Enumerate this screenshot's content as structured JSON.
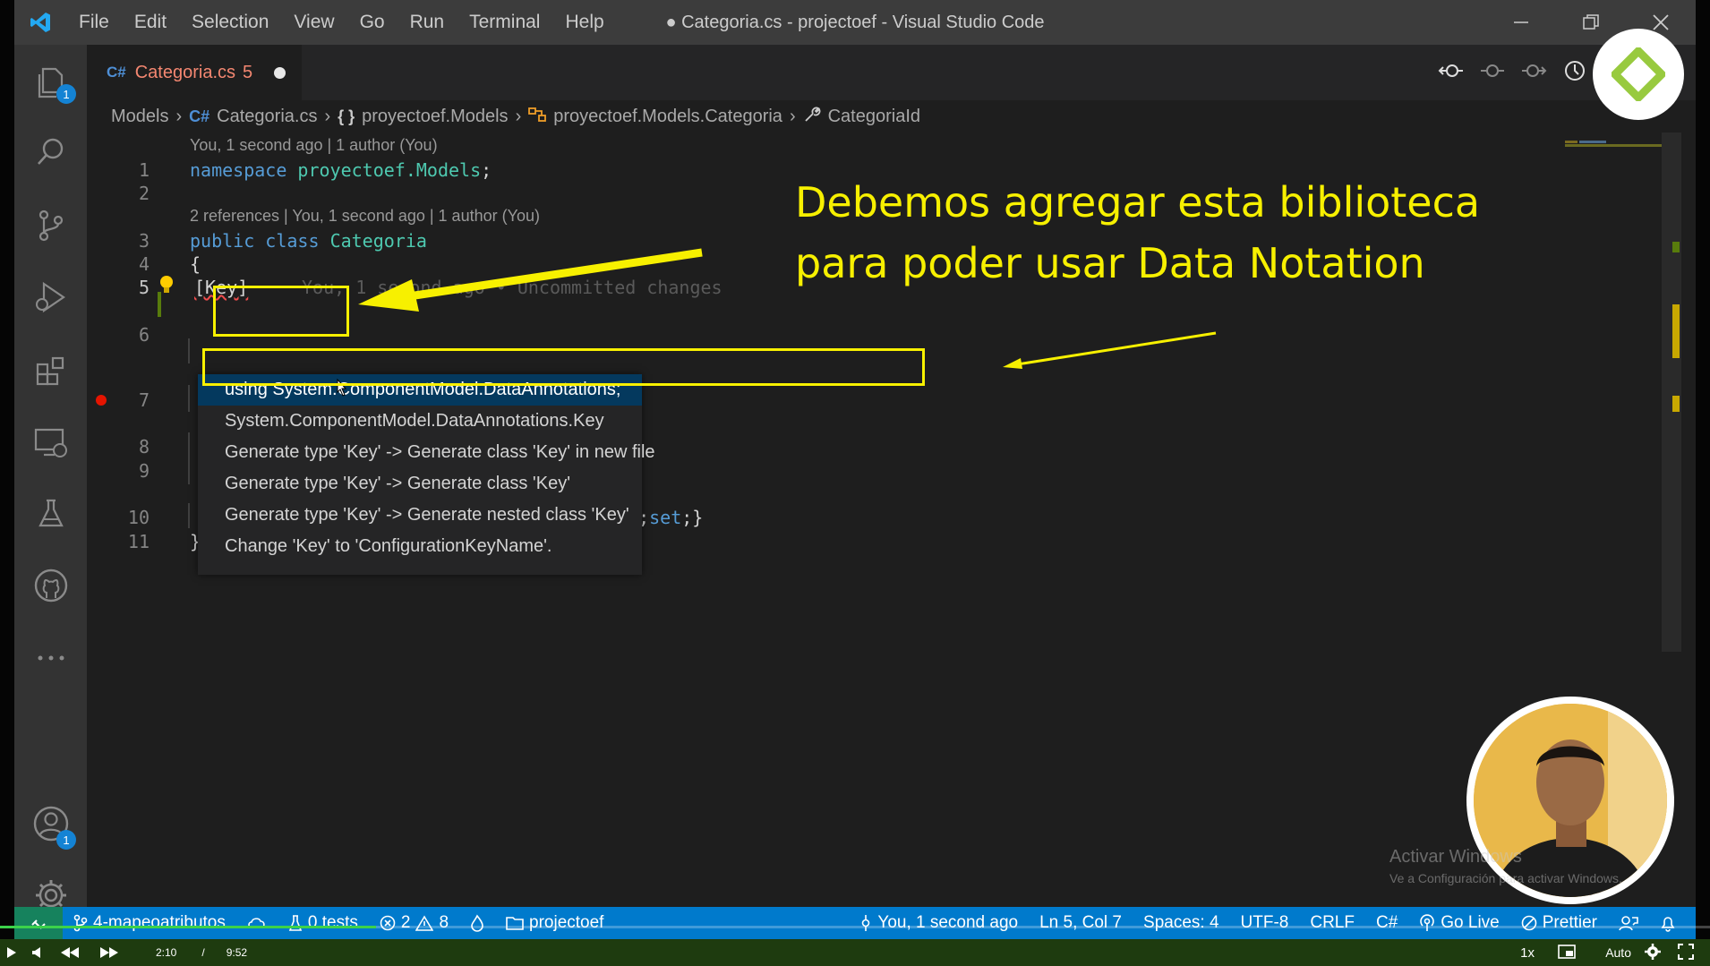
{
  "window": {
    "title": "● Categoria.cs - projectoef - Visual Studio Code",
    "menu": [
      "File",
      "Edit",
      "Selection",
      "View",
      "Go",
      "Run",
      "Terminal",
      "Help"
    ]
  },
  "activity_bar": {
    "explorer_badge": "1",
    "accounts_badge": "1"
  },
  "tab": {
    "name": "Categoria.cs",
    "problems": "5"
  },
  "breadcrumb": {
    "folder": "Models",
    "file_icon": "C#",
    "file": "Categoria.cs",
    "namespace_icon": "{ }",
    "namespace": "proyectoef.Models",
    "class": "proyectoef.Models.Categoria",
    "property": "CategoriaId"
  },
  "code": {
    "lens_1": "You, 1 second ago | 1 author (You)",
    "lens_2": "2 references | You, 1 second ago | 1 author (You)",
    "line_numbers": [
      "1",
      "2",
      "3",
      "4",
      "5",
      "6",
      "7",
      "8",
      "9",
      "10",
      "11"
    ],
    "line1_kw": "namespace",
    "line1_ns": "proyectoef.Models",
    "line1_end": ";",
    "line3_kw1": "public",
    "line3_kw2": "class",
    "line3_cls": "Categoria",
    "line4": "{",
    "line5_code": "[Key]",
    "line5_ghost": "You, 1 second ago • Uncommitted changes",
    "line10_tail_a": "et",
    "line10_tail_b": ";",
    "line10_tail_c": "set",
    "line10_tail_d": ";}",
    "line11": "}"
  },
  "quick_fix": {
    "items": [
      "using System.ComponentModel.DataAnnotations;",
      "System.ComponentModel.DataAnnotations.Key",
      "Generate type 'Key' -> Generate class 'Key' in new file",
      "Generate type 'Key' -> Generate class 'Key'",
      "Generate type 'Key' -> Generate nested class 'Key'",
      "Change 'Key' to 'ConfigurationKeyName'."
    ],
    "selected_index": 0
  },
  "annotation": {
    "line1": "Debemos agregar esta biblioteca",
    "line2": "para poder usar Data Notation",
    "color": "#f7f000"
  },
  "status_bar": {
    "branch": "4-mapeoatributos",
    "tests": "0 tests",
    "errors": "2",
    "warnings": "8",
    "folder": "projectoef",
    "blame": "You, 1 second ago",
    "position": "Ln 5, Col 7",
    "spaces": "Spaces: 4",
    "encoding": "UTF-8",
    "eol": "CRLF",
    "language": "C#",
    "go_live": "Go Live",
    "prettier": "Prettier",
    "color": "#007acc"
  },
  "player": {
    "current": "2:10",
    "separator": "/",
    "duration": "9:52",
    "progress": 0.22,
    "speed": "1x",
    "quality": "Auto"
  },
  "watermark": {
    "line1": "Activar Windows",
    "line2": "Ve a Configuración para activar Windows."
  }
}
